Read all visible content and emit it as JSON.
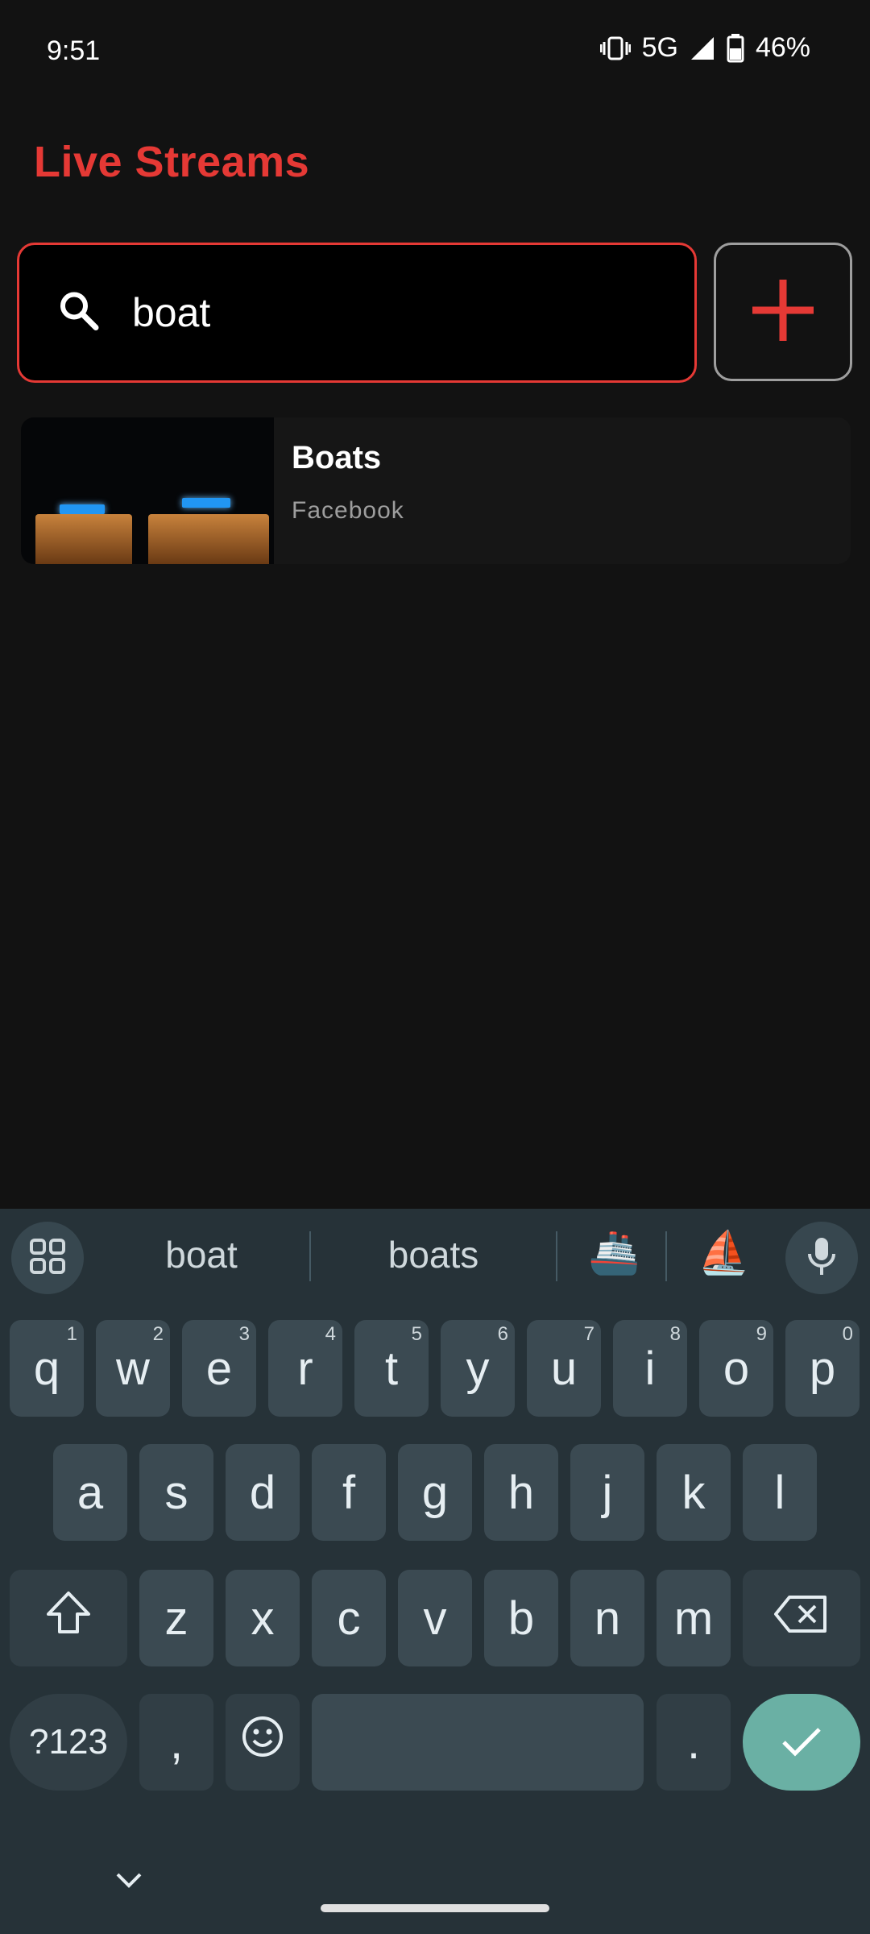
{
  "status": {
    "time": "9:51",
    "network": "5G",
    "battery": "46%",
    "vibrate_icon": "vibrate-icon",
    "signal_icon": "signal-icon",
    "battery_icon": "battery-icon"
  },
  "header": {
    "title": "Live Streams"
  },
  "search": {
    "value": "boat",
    "icon": "search-icon"
  },
  "add_button": {
    "icon": "plus-icon",
    "color": "#e53935"
  },
  "results": [
    {
      "title": "Boats",
      "source": "Facebook"
    }
  ],
  "keyboard": {
    "suggestions": [
      "boat",
      "boats"
    ],
    "emoji_suggestions": [
      "🚢",
      "⛵"
    ],
    "row1": [
      {
        "k": "q",
        "h": "1"
      },
      {
        "k": "w",
        "h": "2"
      },
      {
        "k": "e",
        "h": "3"
      },
      {
        "k": "r",
        "h": "4"
      },
      {
        "k": "t",
        "h": "5"
      },
      {
        "k": "y",
        "h": "6"
      },
      {
        "k": "u",
        "h": "7"
      },
      {
        "k": "i",
        "h": "8"
      },
      {
        "k": "o",
        "h": "9"
      },
      {
        "k": "p",
        "h": "0"
      }
    ],
    "row2": [
      "a",
      "s",
      "d",
      "f",
      "g",
      "h",
      "j",
      "k",
      "l"
    ],
    "row3": [
      "z",
      "x",
      "c",
      "v",
      "b",
      "n",
      "m"
    ],
    "symbols_key": "?123",
    "comma_key": ",",
    "period_key": "."
  },
  "colors": {
    "accent": "#e53935",
    "enter": "#6ab0a4",
    "keyboard_bg": "#263238"
  }
}
